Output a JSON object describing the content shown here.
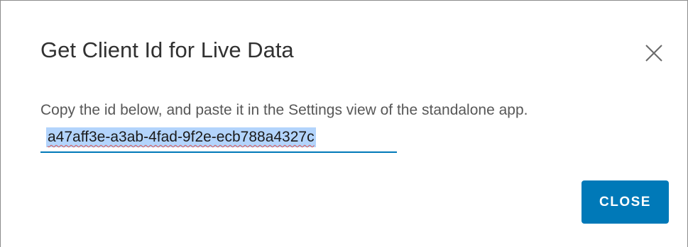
{
  "dialog": {
    "title": "Get Client Id for Live Data",
    "message": "Copy the id below, and paste it in the Settings view of the standalone app.",
    "client_id": "a47aff3e-a3ab-4fad-9f2e-ecb788a4327c",
    "close_label": "CLOSE",
    "close_icon": "close-x-icon"
  },
  "colors": {
    "primary": "#0079b8",
    "selection": "#b3d4fc",
    "title_text": "#313131",
    "body_text": "#575757"
  }
}
